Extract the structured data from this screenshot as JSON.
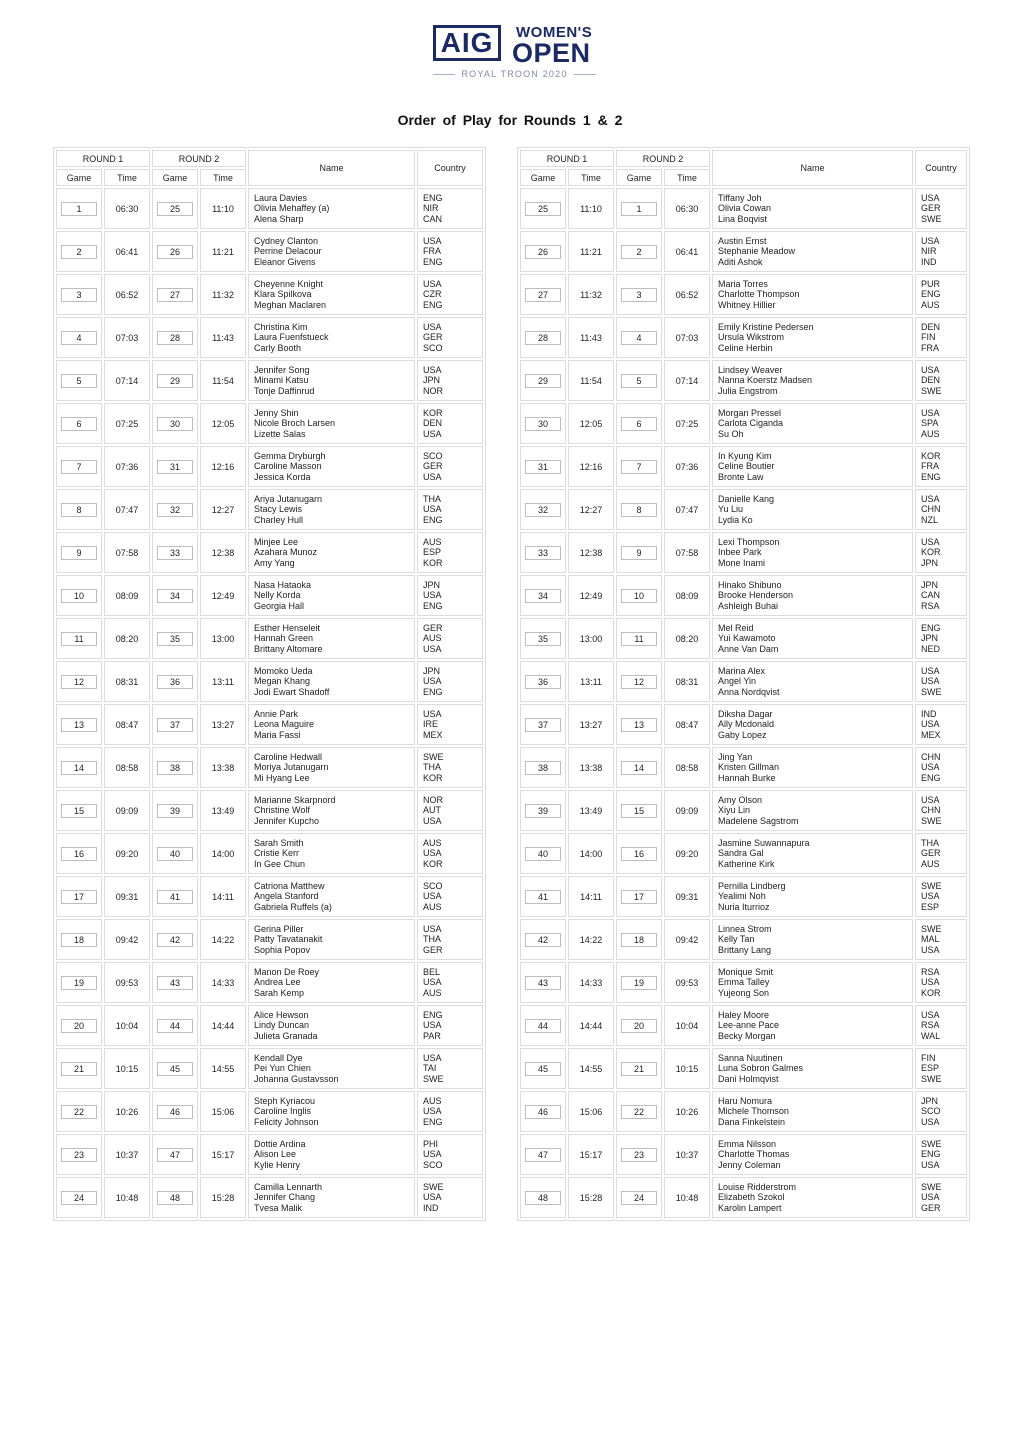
{
  "logo": {
    "brand": "AIG",
    "event_line1": "WOMEN'S",
    "event_line2": "OPEN",
    "venue": "ROYAL TROON 2020"
  },
  "title": "Order of Play for Rounds 1 & 2",
  "headers": {
    "round1": "ROUND 1",
    "round2": "ROUND 2",
    "game": "Game",
    "time": "Time",
    "name": "Name",
    "country": "Country"
  },
  "left_table": [
    {
      "r1_game": "1",
      "r1_time": "06:30",
      "r2_game": "25",
      "r2_time": "11:10",
      "players": [
        "Laura Davies",
        "Olivia Mehaffey (a)",
        "Alena Sharp"
      ],
      "countries": [
        "ENG",
        "NIR",
        "CAN"
      ]
    },
    {
      "r1_game": "2",
      "r1_time": "06:41",
      "r2_game": "26",
      "r2_time": "11:21",
      "players": [
        "Cydney Clanton",
        "Perrine Delacour",
        "Eleanor Givens"
      ],
      "countries": [
        "USA",
        "FRA",
        "ENG"
      ]
    },
    {
      "r1_game": "3",
      "r1_time": "06:52",
      "r2_game": "27",
      "r2_time": "11:32",
      "players": [
        "Cheyenne Knight",
        "Klara Spilkova",
        "Meghan Maclaren"
      ],
      "countries": [
        "USA",
        "CZR",
        "ENG"
      ]
    },
    {
      "r1_game": "4",
      "r1_time": "07:03",
      "r2_game": "28",
      "r2_time": "11:43",
      "players": [
        "Christina Kim",
        "Laura Fuenfstueck",
        "Carly Booth"
      ],
      "countries": [
        "USA",
        "GER",
        "SCO"
      ]
    },
    {
      "r1_game": "5",
      "r1_time": "07:14",
      "r2_game": "29",
      "r2_time": "11:54",
      "players": [
        "Jennifer Song",
        "Minami Katsu",
        "Tonje Daffinrud"
      ],
      "countries": [
        "USA",
        "JPN",
        "NOR"
      ]
    },
    {
      "r1_game": "6",
      "r1_time": "07:25",
      "r2_game": "30",
      "r2_time": "12:05",
      "players": [
        "Jenny Shin",
        "Nicole Broch Larsen",
        "Lizette Salas"
      ],
      "countries": [
        "KOR",
        "DEN",
        "USA"
      ]
    },
    {
      "r1_game": "7",
      "r1_time": "07:36",
      "r2_game": "31",
      "r2_time": "12:16",
      "players": [
        "Gemma Dryburgh",
        "Caroline Masson",
        "Jessica Korda"
      ],
      "countries": [
        "SCO",
        "GER",
        "USA"
      ]
    },
    {
      "r1_game": "8",
      "r1_time": "07:47",
      "r2_game": "32",
      "r2_time": "12:27",
      "players": [
        "Ariya Jutanugarn",
        "Stacy Lewis",
        "Charley Hull"
      ],
      "countries": [
        "THA",
        "USA",
        "ENG"
      ]
    },
    {
      "r1_game": "9",
      "r1_time": "07:58",
      "r2_game": "33",
      "r2_time": "12:38",
      "players": [
        "Minjee Lee",
        "Azahara Munoz",
        "Amy Yang"
      ],
      "countries": [
        "AUS",
        "ESP",
        "KOR"
      ]
    },
    {
      "r1_game": "10",
      "r1_time": "08:09",
      "r2_game": "34",
      "r2_time": "12:49",
      "players": [
        "Nasa Hataoka",
        "Nelly Korda",
        "Georgia Hall"
      ],
      "countries": [
        "JPN",
        "USA",
        "ENG"
      ]
    },
    {
      "r1_game": "11",
      "r1_time": "08:20",
      "r2_game": "35",
      "r2_time": "13:00",
      "players": [
        "Esther Henseleit",
        "Hannah Green",
        "Brittany Altomare"
      ],
      "countries": [
        "GER",
        "AUS",
        "USA"
      ]
    },
    {
      "r1_game": "12",
      "r1_time": "08:31",
      "r2_game": "36",
      "r2_time": "13:11",
      "players": [
        "Momoko Ueda",
        "Megan Khang",
        "Jodi Ewart Shadoff"
      ],
      "countries": [
        "JPN",
        "USA",
        "ENG"
      ]
    },
    {
      "r1_game": "13",
      "r1_time": "08:47",
      "r2_game": "37",
      "r2_time": "13:27",
      "players": [
        "Annie Park",
        "Leona Maguire",
        "Maria Fassi"
      ],
      "countries": [
        "USA",
        "IRE",
        "MEX"
      ]
    },
    {
      "r1_game": "14",
      "r1_time": "08:58",
      "r2_game": "38",
      "r2_time": "13:38",
      "players": [
        "Caroline Hedwall",
        "Moriya Jutanugarn",
        "Mi Hyang Lee"
      ],
      "countries": [
        "SWE",
        "THA",
        "KOR"
      ]
    },
    {
      "r1_game": "15",
      "r1_time": "09:09",
      "r2_game": "39",
      "r2_time": "13:49",
      "players": [
        "Marianne Skarpnord",
        "Christine Wolf",
        "Jennifer Kupcho"
      ],
      "countries": [
        "NOR",
        "AUT",
        "USA"
      ]
    },
    {
      "r1_game": "16",
      "r1_time": "09:20",
      "r2_game": "40",
      "r2_time": "14:00",
      "players": [
        "Sarah Smith",
        "Cristie Kerr",
        "In Gee Chun"
      ],
      "countries": [
        "AUS",
        "USA",
        "KOR"
      ]
    },
    {
      "r1_game": "17",
      "r1_time": "09:31",
      "r2_game": "41",
      "r2_time": "14:11",
      "players": [
        "Catriona Matthew",
        "Angela Stanford",
        "Gabriela Ruffels (a)"
      ],
      "countries": [
        "SCO",
        "USA",
        "AUS"
      ]
    },
    {
      "r1_game": "18",
      "r1_time": "09:42",
      "r2_game": "42",
      "r2_time": "14:22",
      "players": [
        "Gerina Piller",
        "Patty Tavatanakit",
        "Sophia Popov"
      ],
      "countries": [
        "USA",
        "THA",
        "GER"
      ]
    },
    {
      "r1_game": "19",
      "r1_time": "09:53",
      "r2_game": "43",
      "r2_time": "14:33",
      "players": [
        "Manon De Roey",
        "Andrea Lee",
        "Sarah Kemp"
      ],
      "countries": [
        "BEL",
        "USA",
        "AUS"
      ]
    },
    {
      "r1_game": "20",
      "r1_time": "10:04",
      "r2_game": "44",
      "r2_time": "14:44",
      "players": [
        "Alice Hewson",
        "Lindy Duncan",
        "Julieta Granada"
      ],
      "countries": [
        "ENG",
        "USA",
        "PAR"
      ]
    },
    {
      "r1_game": "21",
      "r1_time": "10:15",
      "r2_game": "45",
      "r2_time": "14:55",
      "players": [
        "Kendall Dye",
        "Pei Yun Chien",
        "Johanna Gustavsson"
      ],
      "countries": [
        "USA",
        "TAI",
        "SWE"
      ]
    },
    {
      "r1_game": "22",
      "r1_time": "10:26",
      "r2_game": "46",
      "r2_time": "15:06",
      "players": [
        "Steph Kyriacou",
        "Caroline Inglis",
        "Felicity Johnson"
      ],
      "countries": [
        "AUS",
        "USA",
        "ENG"
      ]
    },
    {
      "r1_game": "23",
      "r1_time": "10:37",
      "r2_game": "47",
      "r2_time": "15:17",
      "players": [
        "Dottie Ardina",
        "Alison Lee",
        "Kylie Henry"
      ],
      "countries": [
        "PHI",
        "USA",
        "SCO"
      ]
    },
    {
      "r1_game": "24",
      "r1_time": "10:48",
      "r2_game": "48",
      "r2_time": "15:28",
      "players": [
        "Camilla Lennarth",
        "Jennifer Chang",
        "Tvesa Malik"
      ],
      "countries": [
        "SWE",
        "USA",
        "IND"
      ]
    }
  ],
  "right_table": [
    {
      "r1_game": "25",
      "r1_time": "11:10",
      "r2_game": "1",
      "r2_time": "06:30",
      "players": [
        "Tiffany Joh",
        "Olivia Cowan",
        "Lina Boqvist"
      ],
      "countries": [
        "USA",
        "GER",
        "SWE"
      ]
    },
    {
      "r1_game": "26",
      "r1_time": "11:21",
      "r2_game": "2",
      "r2_time": "06:41",
      "players": [
        "Austin Ernst",
        "Stephanie Meadow",
        "Aditi Ashok"
      ],
      "countries": [
        "USA",
        "NIR",
        "IND"
      ]
    },
    {
      "r1_game": "27",
      "r1_time": "11:32",
      "r2_game": "3",
      "r2_time": "06:52",
      "players": [
        "Maria Torres",
        "Charlotte Thompson",
        "Whitney Hillier"
      ],
      "countries": [
        "PUR",
        "ENG",
        "AUS"
      ]
    },
    {
      "r1_game": "28",
      "r1_time": "11:43",
      "r2_game": "4",
      "r2_time": "07:03",
      "players": [
        "Emily Kristine Pedersen",
        "Ursula Wikstrom",
        "Celine Herbin"
      ],
      "countries": [
        "DEN",
        "FIN",
        "FRA"
      ]
    },
    {
      "r1_game": "29",
      "r1_time": "11:54",
      "r2_game": "5",
      "r2_time": "07:14",
      "players": [
        "Lindsey Weaver",
        "Nanna Koerstz Madsen",
        "Julia Engstrom"
      ],
      "countries": [
        "USA",
        "DEN",
        "SWE"
      ]
    },
    {
      "r1_game": "30",
      "r1_time": "12:05",
      "r2_game": "6",
      "r2_time": "07:25",
      "players": [
        "Morgan Pressel",
        "Carlota Ciganda",
        "Su Oh"
      ],
      "countries": [
        "USA",
        "SPA",
        "AUS"
      ]
    },
    {
      "r1_game": "31",
      "r1_time": "12:16",
      "r2_game": "7",
      "r2_time": "07:36",
      "players": [
        "In Kyung Kim",
        "Celine Boutier",
        "Bronte Law"
      ],
      "countries": [
        "KOR",
        "FRA",
        "ENG"
      ]
    },
    {
      "r1_game": "32",
      "r1_time": "12:27",
      "r2_game": "8",
      "r2_time": "07:47",
      "players": [
        "Danielle Kang",
        "Yu Liu",
        "Lydia Ko"
      ],
      "countries": [
        "USA",
        "CHN",
        "NZL"
      ]
    },
    {
      "r1_game": "33",
      "r1_time": "12:38",
      "r2_game": "9",
      "r2_time": "07:58",
      "players": [
        "Lexi Thompson",
        "Inbee Park",
        "Mone Inami"
      ],
      "countries": [
        "USA",
        "KOR",
        "JPN"
      ]
    },
    {
      "r1_game": "34",
      "r1_time": "12:49",
      "r2_game": "10",
      "r2_time": "08:09",
      "players": [
        "Hinako Shibuno",
        "Brooke Henderson",
        "Ashleigh Buhai"
      ],
      "countries": [
        "JPN",
        "CAN",
        "RSA"
      ]
    },
    {
      "r1_game": "35",
      "r1_time": "13:00",
      "r2_game": "11",
      "r2_time": "08:20",
      "players": [
        "Mel Reid",
        "Yui Kawamoto",
        "Anne Van Dam"
      ],
      "countries": [
        "ENG",
        "JPN",
        "NED"
      ]
    },
    {
      "r1_game": "36",
      "r1_time": "13:11",
      "r2_game": "12",
      "r2_time": "08:31",
      "players": [
        "Marina Alex",
        "Angel Yin",
        "Anna Nordqvist"
      ],
      "countries": [
        "USA",
        "USA",
        "SWE"
      ]
    },
    {
      "r1_game": "37",
      "r1_time": "13:27",
      "r2_game": "13",
      "r2_time": "08:47",
      "players": [
        "Diksha Dagar",
        "Ally Mcdonald",
        "Gaby Lopez"
      ],
      "countries": [
        "IND",
        "USA",
        "MEX"
      ]
    },
    {
      "r1_game": "38",
      "r1_time": "13:38",
      "r2_game": "14",
      "r2_time": "08:58",
      "players": [
        "Jing Yan",
        "Kristen Gillman",
        "Hannah Burke"
      ],
      "countries": [
        "CHN",
        "USA",
        "ENG"
      ]
    },
    {
      "r1_game": "39",
      "r1_time": "13:49",
      "r2_game": "15",
      "r2_time": "09:09",
      "players": [
        "Amy Olson",
        "Xiyu Lin",
        "Madelene Sagstrom"
      ],
      "countries": [
        "USA",
        "CHN",
        "SWE"
      ]
    },
    {
      "r1_game": "40",
      "r1_time": "14:00",
      "r2_game": "16",
      "r2_time": "09:20",
      "players": [
        "Jasmine Suwannapura",
        "Sandra Gal",
        "Katherine Kirk"
      ],
      "countries": [
        "THA",
        "GER",
        "AUS"
      ]
    },
    {
      "r1_game": "41",
      "r1_time": "14:11",
      "r2_game": "17",
      "r2_time": "09:31",
      "players": [
        "Pernilla Lindberg",
        "Yealimi Noh",
        "Nuria Iturrioz"
      ],
      "countries": [
        "SWE",
        "USA",
        "ESP"
      ]
    },
    {
      "r1_game": "42",
      "r1_time": "14:22",
      "r2_game": "18",
      "r2_time": "09:42",
      "players": [
        "Linnea Strom",
        "Kelly Tan",
        "Brittany Lang"
      ],
      "countries": [
        "SWE",
        "MAL",
        "USA"
      ]
    },
    {
      "r1_game": "43",
      "r1_time": "14:33",
      "r2_game": "19",
      "r2_time": "09:53",
      "players": [
        "Monique Smit",
        "Emma Talley",
        "Yujeong Son"
      ],
      "countries": [
        "RSA",
        "USA",
        "KOR"
      ]
    },
    {
      "r1_game": "44",
      "r1_time": "14:44",
      "r2_game": "20",
      "r2_time": "10:04",
      "players": [
        "Haley Moore",
        "Lee-anne Pace",
        "Becky Morgan"
      ],
      "countries": [
        "USA",
        "RSA",
        "WAL"
      ]
    },
    {
      "r1_game": "45",
      "r1_time": "14:55",
      "r2_game": "21",
      "r2_time": "10:15",
      "players": [
        "Sanna Nuutinen",
        "Luna Sobron Galmes",
        "Dani Holmqvist"
      ],
      "countries": [
        "FIN",
        "ESP",
        "SWE"
      ]
    },
    {
      "r1_game": "46",
      "r1_time": "15:06",
      "r2_game": "22",
      "r2_time": "10:26",
      "players": [
        "Haru Nomura",
        "Michele Thomson",
        "Dana Finkelstein"
      ],
      "countries": [
        "JPN",
        "SCO",
        "USA"
      ]
    },
    {
      "r1_game": "47",
      "r1_time": "15:17",
      "r2_game": "23",
      "r2_time": "10:37",
      "players": [
        "Emma Nilsson",
        "Charlotte Thomas",
        "Jenny Coleman"
      ],
      "countries": [
        "SWE",
        "ENG",
        "USA"
      ]
    },
    {
      "r1_game": "48",
      "r1_time": "15:28",
      "r2_game": "24",
      "r2_time": "10:48",
      "players": [
        "Louise Ridderstrom",
        "Elizabeth Szokol",
        "Karolin Lampert"
      ],
      "countries": [
        "SWE",
        "USA",
        "GER"
      ]
    }
  ]
}
